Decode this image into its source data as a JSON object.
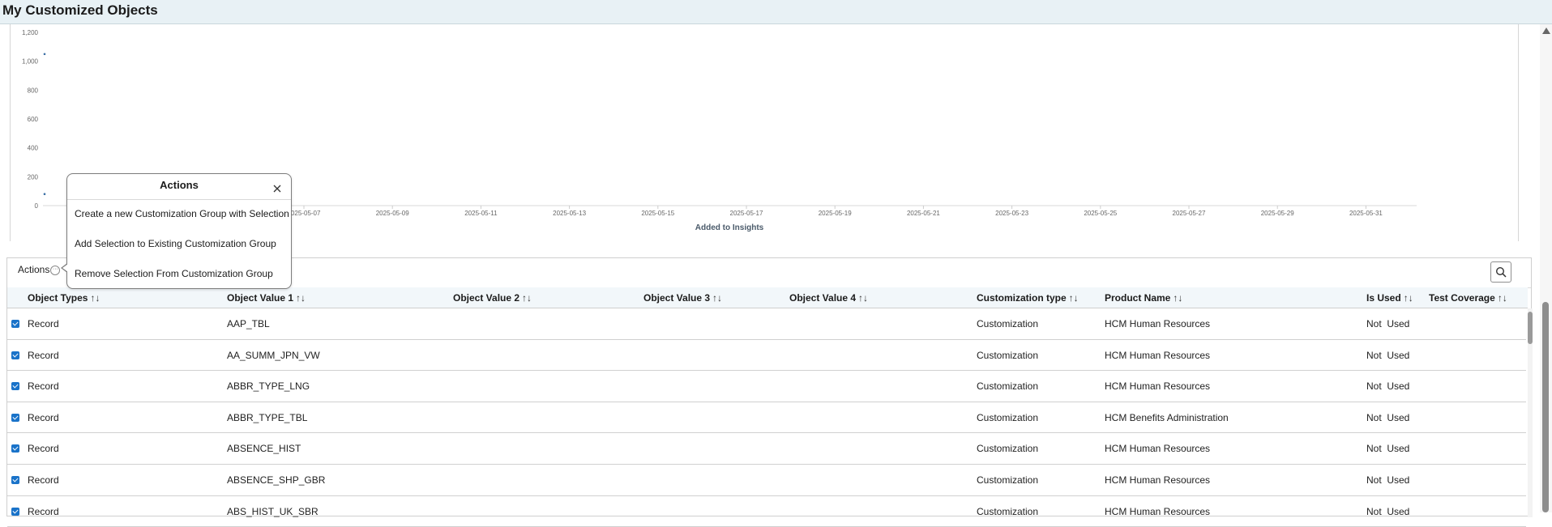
{
  "header": {
    "title": "My Customized Objects"
  },
  "chart_data": {
    "type": "scatter",
    "xlabel": "Added to Insights",
    "ylim": [
      0,
      1200
    ],
    "yticks": [
      "0",
      "200",
      "400",
      "600",
      "800",
      "1,000",
      "1,200"
    ],
    "xticks": [
      "2025-05-07",
      "2025-05-09",
      "2025-05-11",
      "2025-05-13",
      "2025-05-15",
      "2025-05-17",
      "2025-05-19",
      "2025-05-21",
      "2025-05-23",
      "2025-05-25",
      "2025-05-27",
      "2025-05-29",
      "2025-05-31"
    ],
    "points": [
      {
        "y": 1050
      },
      {
        "y": 80
      }
    ],
    "grid": false
  },
  "toolbar": {
    "actions_label": "Actions",
    "dots": "···"
  },
  "popover": {
    "title": "Actions",
    "items": [
      "Create a new Customization Group with Selection",
      "Add Selection to Existing Customization Group",
      "Remove Selection From Customization Group"
    ]
  },
  "table": {
    "sort_glyph": "↑↓",
    "columns": [
      "Object Types",
      "Object Value 1",
      "Object Value 2",
      "Object Value 3",
      "Object Value 4",
      "Customization type",
      "Product Name",
      "Is Used",
      "Test Coverage"
    ],
    "rows": [
      {
        "type": "Record",
        "v1": "AAP_TBL",
        "ctype": "Customization",
        "product": "HCM Human Resources",
        "used": "Not  Used"
      },
      {
        "type": "Record",
        "v1": "AA_SUMM_JPN_VW",
        "ctype": "Customization",
        "product": "HCM Human Resources",
        "used": "Not  Used"
      },
      {
        "type": "Record",
        "v1": "ABBR_TYPE_LNG",
        "ctype": "Customization",
        "product": "HCM Human Resources",
        "used": "Not  Used"
      },
      {
        "type": "Record",
        "v1": "ABBR_TYPE_TBL",
        "ctype": "Customization",
        "product": "HCM Benefits Administration",
        "used": "Not  Used"
      },
      {
        "type": "Record",
        "v1": "ABSENCE_HIST",
        "ctype": "Customization",
        "product": "HCM Human Resources",
        "used": "Not  Used"
      },
      {
        "type": "Record",
        "v1": "ABSENCE_SHP_GBR",
        "ctype": "Customization",
        "product": "HCM Human Resources",
        "used": "Not  Used"
      },
      {
        "type": "Record",
        "v1": "ABS_HIST_UK_SBR",
        "ctype": "Customization",
        "product": "HCM Human Resources",
        "used": "Not  Used"
      }
    ]
  }
}
